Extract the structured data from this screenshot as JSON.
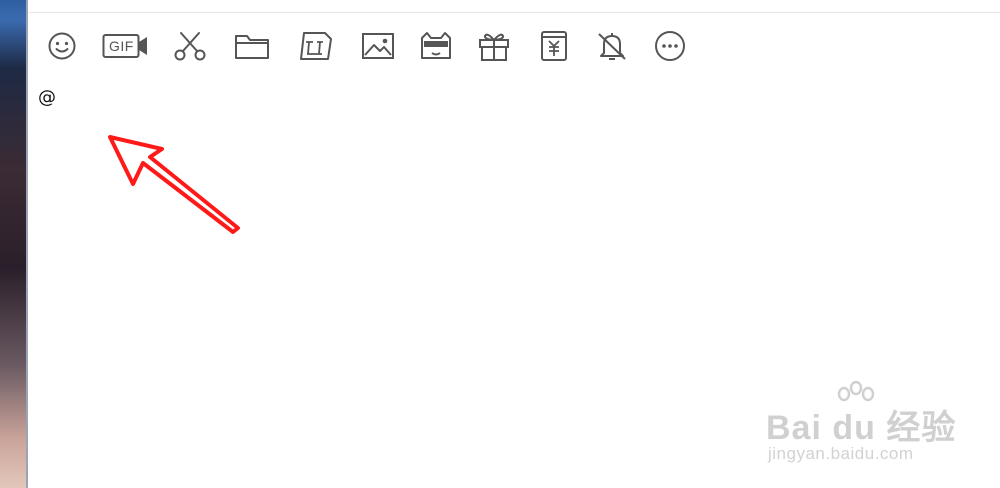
{
  "toolbar": {
    "icons": [
      {
        "name": "emoji-icon"
      },
      {
        "name": "gif-icon"
      },
      {
        "name": "scissors-icon"
      },
      {
        "name": "folder-icon"
      },
      {
        "name": "doc-image-icon"
      },
      {
        "name": "image-icon"
      },
      {
        "name": "cat-sticker-icon"
      },
      {
        "name": "gift-icon"
      },
      {
        "name": "red-packet-icon"
      },
      {
        "name": "bell-off-icon"
      },
      {
        "name": "more-icon"
      }
    ],
    "gif_label": "GIF"
  },
  "composer": {
    "text": "@"
  },
  "annotation": {
    "arrow_color": "#ff1a1a"
  },
  "watermark": {
    "logo_text": "Bai du 经验",
    "sub_text": "jingyan.baidu.com"
  },
  "colors": {
    "icon_stroke": "#555555",
    "divider": "#e6e6e6"
  }
}
